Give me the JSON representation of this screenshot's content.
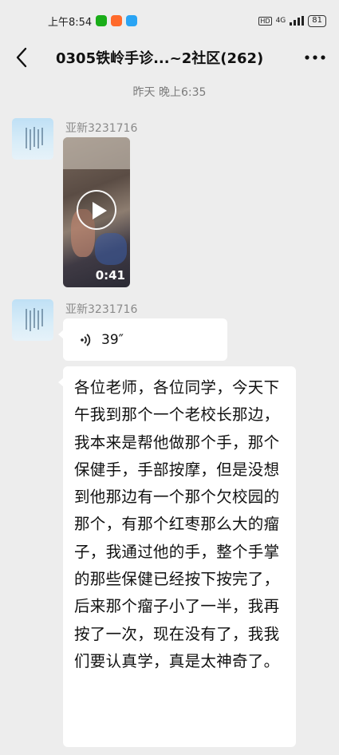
{
  "status_bar": {
    "time": "上午8:54",
    "network": "4G",
    "battery": "81"
  },
  "nav": {
    "title": "0305铁岭手诊...~2社区(262)",
    "back_icon": "chevron-left-icon",
    "more_icon": "more-dots-icon"
  },
  "timestamp": "昨天 晚上6:35",
  "messages": [
    {
      "sender": "亚新3231716",
      "type": "video",
      "duration": "0:41"
    },
    {
      "sender": "亚新3231716",
      "type": "voice",
      "duration": "39″",
      "icon": "voice-wave-icon"
    },
    {
      "type": "text",
      "text": "各位老师，各位同学，今天下午我到那个一个老校长那边，我本来是帮他做那个手，那个保健手，手部按摩，但是没想到他那边有一个那个欠校园的那个，有那个红枣那么大的瘤子，我通过他的手，整个手掌的那些保健已经按下按完了，后来那个瘤子小了一半，我再按了一次，现在没有了，我我们要认真学，真是太神奇了。"
    }
  ]
}
